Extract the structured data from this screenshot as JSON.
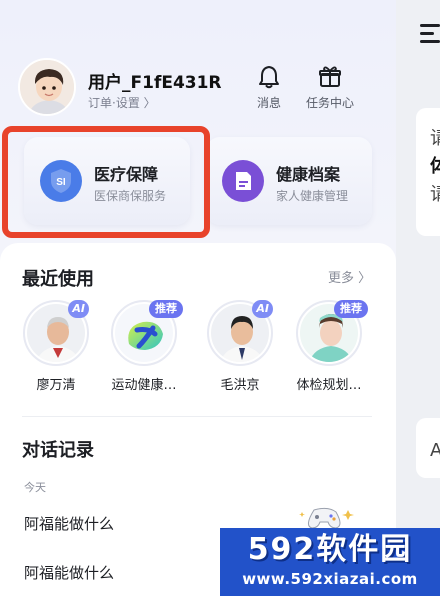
{
  "user": {
    "name": "用户_F1fE431R",
    "subline": "订单·设置 〉"
  },
  "top_actions": [
    {
      "label": "消息",
      "icon": "bell-icon"
    },
    {
      "label": "任务中心",
      "icon": "gift-icon"
    }
  ],
  "features": [
    {
      "title": "医疗保障",
      "desc": "医保商保服务",
      "icon": "shield-si-icon",
      "icon_text": "SI",
      "color": "#4a7ce8"
    },
    {
      "title": "健康档案",
      "desc": "家人健康管理",
      "icon": "document-icon",
      "color": "#7a4fd6"
    }
  ],
  "recent": {
    "title": "最近使用",
    "more": "更多 〉",
    "agents": [
      {
        "name": "廖万清",
        "badge": "AI"
      },
      {
        "name": "运动健康…",
        "badge": "推荐"
      },
      {
        "name": "毛洪京",
        "badge": "AI"
      },
      {
        "name": "体检规划…",
        "badge": "推荐"
      }
    ]
  },
  "history": {
    "title": "对话记录",
    "day_label": "今天",
    "items": [
      "阿福能做什么",
      "阿福能做什么"
    ]
  },
  "background_page": {
    "chars": [
      "请",
      "体",
      "请",
      "A"
    ]
  },
  "watermark": {
    "title": "592软件园",
    "url": "www.592xiazai.com"
  },
  "colors": {
    "accent": "#6b74f0",
    "highlight_border": "#e8432b",
    "watermark_bg": "#2252c9"
  }
}
